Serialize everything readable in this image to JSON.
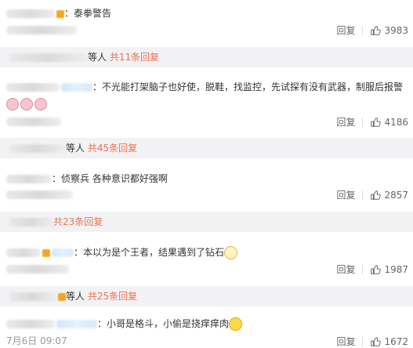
{
  "comments": [
    {
      "sep": "：",
      "text": "泰拳警告",
      "likes": "3983",
      "time": ""
    },
    {
      "sep": "：",
      "text": "不光能打架脑子也好使，脱鞋，找监控，先试探有没有武器，制服后报警",
      "likes": "4186",
      "time": ""
    },
    {
      "sep": "：",
      "text": "侦察兵 各种意识都好强啊",
      "likes": "2857",
      "time": ""
    },
    {
      "sep": "：",
      "text": "本以为是个王者，结果遇到了钻石",
      "likes": "1987",
      "time": ""
    },
    {
      "sep": "：",
      "text": "小哥是格斗，小偷是挠痒痒肉",
      "likes": "1672",
      "time": "7月6日 09:07"
    }
  ],
  "summaries": [
    {
      "deng": "等人",
      "count": "共11条回复"
    },
    {
      "deng": "等人",
      "count": "共45条回复"
    },
    {
      "deng": "",
      "count": "共23条回复"
    },
    {
      "deng": "等人",
      "count": "共25条回复"
    }
  ],
  "actions": {
    "reply_label": "回复"
  },
  "icons": {
    "like": "thumbs-up-icon"
  },
  "colors": {
    "accent": "#eb7350",
    "summary_bg": "#f2f2f5",
    "muted": "#999999"
  }
}
